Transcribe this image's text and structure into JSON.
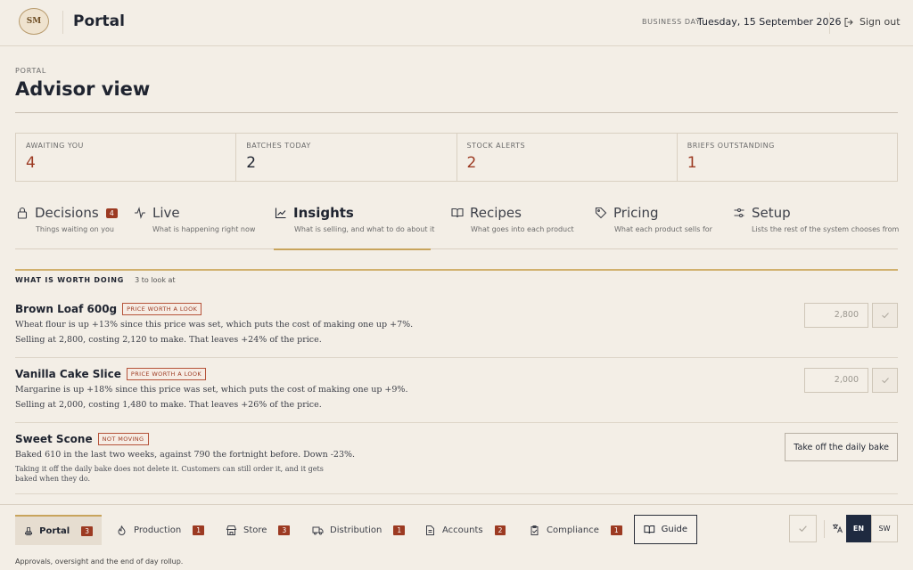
{
  "header": {
    "logo_text": "SM",
    "app_title": "Portal",
    "business_day_label": "BUSINESS DAY",
    "business_day_value": "Tuesday, 15 September 2026",
    "sign_out": "Sign out"
  },
  "page": {
    "kicker": "PORTAL",
    "title": "Advisor view"
  },
  "stats": [
    {
      "label": "AWAITING YOU",
      "value": "4"
    },
    {
      "label": "BATCHES TODAY",
      "value": "2"
    },
    {
      "label": "STOCK ALERTS",
      "value": "2"
    },
    {
      "label": "BRIEFS OUTSTANDING",
      "value": "1"
    }
  ],
  "tabs": [
    {
      "label": "Decisions",
      "sub": "Things waiting on you",
      "badge": "4",
      "icon": "lock-icon"
    },
    {
      "label": "Live",
      "sub": "What is happening right now",
      "icon": "activity-icon"
    },
    {
      "label": "Insights",
      "sub": "What is selling, and what to do about it",
      "icon": "chart-icon"
    },
    {
      "label": "Recipes",
      "sub": "What goes into each product",
      "icon": "book-icon"
    },
    {
      "label": "Pricing",
      "sub": "What each product sells for",
      "icon": "tag-icon"
    },
    {
      "label": "Setup",
      "sub": "Lists the rest of the system chooses from",
      "icon": "sliders-icon"
    }
  ],
  "section": {
    "title": "WHAT IS WORTH DOING",
    "count": "3 to look at"
  },
  "items": [
    {
      "name": "Brown Loaf 600g",
      "tag": "PRICE WORTH A LOOK",
      "line1": "Wheat flour is up +13% since this price was set, which puts the cost of making one up +7%.",
      "line2": "Selling at 2,800, costing 2,120 to make. That leaves +24% of the price.",
      "price": "2,800"
    },
    {
      "name": "Vanilla Cake Slice",
      "tag": "PRICE WORTH A LOOK",
      "line1": "Margarine is up +18% since this price was set, which puts the cost of making one up +9%.",
      "line2": "Selling at 2,000, costing 1,480 to make. That leaves +26% of the price.",
      "price": "2,000"
    },
    {
      "name": "Sweet Scone",
      "tag": "NOT MOVING",
      "line1": "Baked 610 in the last two weeks, against 790 the fortnight before. Down -23%.",
      "note": "Taking it off the daily bake does not delete it. Customers can still order it, and it gets baked when they do.",
      "action": "Take off the daily bake"
    }
  ],
  "bottom_nav": [
    {
      "label": "Portal",
      "badge": "3",
      "icon": "stamp-icon"
    },
    {
      "label": "Production",
      "badge": "1",
      "icon": "flame-icon"
    },
    {
      "label": "Store",
      "badge": "3",
      "icon": "store-icon"
    },
    {
      "label": "Distribution",
      "badge": "1",
      "icon": "truck-icon"
    },
    {
      "label": "Accounts",
      "badge": "2",
      "icon": "file-icon"
    },
    {
      "label": "Compliance",
      "badge": "1",
      "icon": "clipboard-icon"
    },
    {
      "label": "Guide",
      "icon": "book-icon"
    }
  ],
  "language": {
    "en": "EN",
    "sw": "SW"
  },
  "footnote": "Approvals, oversight and the end of day rollup.",
  "colors": {
    "accent": "#9c3a22",
    "gold": "#c8a45c",
    "navy": "#1f2a40",
    "background": "#f3eee6"
  }
}
